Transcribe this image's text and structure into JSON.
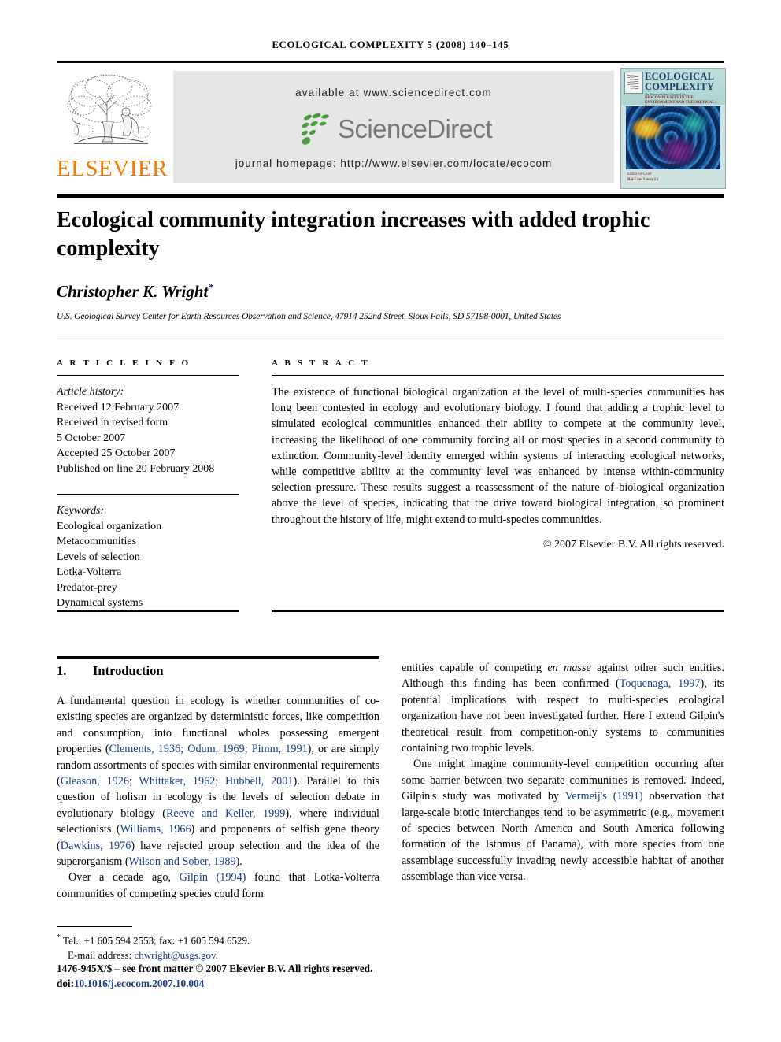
{
  "running_head": "ECOLOGICAL COMPLEXITY 5 (2008) 140–145",
  "masthead": {
    "publisher_name": "ELSEVIER",
    "available_at": "available at www.sciencedirect.com",
    "sciencedirect_logo_text": "ScienceDirect",
    "journal_homepage": "journal homepage: http://www.elsevier.com/locate/ecocom",
    "cover": {
      "title_line1": "ECOLOGICAL",
      "title_line2": "COMPLEXITY",
      "subtitle_italic": "An International Journal on",
      "subtitle_bold": "BIOCOMPLEXITY IN THE ENVIRONMENT AND THEORETICAL ECOLOGY",
      "footer_line1": "Editor-in-Chief",
      "footer_line2": "Bai-Lian Larry Li"
    }
  },
  "title": "Ecological community integration increases with added trophic complexity",
  "author": "Christopher K. Wright",
  "author_footnote_marker": "*",
  "affiliation": "U.S. Geological Survey Center for Earth Resources Observation and Science, 47914 252nd Street, Sioux Falls, SD 57198-0001, United States",
  "article_info": {
    "heading": "A R T I C L E   I N F O",
    "history_label": "Article history:",
    "history": [
      "Received 12 February 2007",
      "Received in revised form",
      "5 October 2007",
      "Accepted 25 October 2007",
      "Published on line 20 February 2008"
    ],
    "keywords_label": "Keywords:",
    "keywords": [
      "Ecological organization",
      "Metacommunities",
      "Levels of selection",
      "Lotka-Volterra",
      "Predator-prey",
      "Dynamical systems"
    ]
  },
  "abstract": {
    "heading": "A B S T R A C T",
    "text": "The existence of functional biological organization at the level of multi-species communities has long been contested in ecology and evolutionary biology. I found that adding a trophic level to simulated ecological communities enhanced their ability to compete at the community level, increasing the likelihood of one community forcing all or most species in a second community to extinction. Community-level identity emerged within systems of interacting ecological networks, while competitive ability at the community level was enhanced by intense within-community selection pressure. These results suggest a reassessment of the nature of biological organization above the level of species, indicating that the drive toward biological integration, so prominent throughout the history of life, might extend to multi-species communities.",
    "copyright": "© 2007 Elsevier B.V. All rights reserved."
  },
  "introduction": {
    "number": "1.",
    "heading": "Introduction",
    "left_paragraphs": [
      {
        "runs": [
          {
            "t": "A fundamental question in ecology is whether communities of co-existing species are organized by deterministic forces, like competition and consumption, into functional wholes possessing emergent properties ("
          },
          {
            "t": "Clements, 1936; Odum, 1969; Pimm, 1991",
            "style": "cite"
          },
          {
            "t": "), or are simply random assortments of species with similar environmental requirements ("
          },
          {
            "t": "Gleason, 1926; Whittaker, 1962; Hubbell, 2001",
            "style": "cite"
          },
          {
            "t": "). Parallel to this question of holism in ecology is the levels of selection debate in evolutionary biology ("
          },
          {
            "t": "Reeve and Keller, 1999",
            "style": "cite"
          },
          {
            "t": "), where individual selectionists ("
          },
          {
            "t": "Williams, 1966",
            "style": "cite"
          },
          {
            "t": ") and proponents of selfish gene theory ("
          },
          {
            "t": "Dawkins, 1976",
            "style": "cite"
          },
          {
            "t": ") have rejected group selection and the idea of the superorganism ("
          },
          {
            "t": "Wilson and Sober, 1989",
            "style": "cite"
          },
          {
            "t": ")."
          }
        ]
      },
      {
        "runs": [
          {
            "t": "Over a decade ago, "
          },
          {
            "t": "Gilpin (1994)",
            "style": "cite"
          },
          {
            "t": " found that Lotka-Volterra communities of competing species could form"
          }
        ]
      }
    ],
    "right_paragraphs": [
      {
        "runs": [
          {
            "t": "entities capable of competing "
          },
          {
            "t": "en masse",
            "style": "ital"
          },
          {
            "t": " against other such entities. Although this finding has been confirmed ("
          },
          {
            "t": "Toquenaga, 1997",
            "style": "cite"
          },
          {
            "t": "), its potential implications with respect to multi-species ecological organization have not been investigated further. Here I extend Gilpin's theoretical result from competition-only systems to communities containing two trophic levels."
          }
        ]
      },
      {
        "runs": [
          {
            "t": "One might imagine community-level competition occurring after some barrier between two separate communities is removed. Indeed, Gilpin's study was motivated by "
          },
          {
            "t": "Vermeij's (1991)",
            "style": "cite"
          },
          {
            "t": " observation that large-scale biotic interchanges tend to be asymmetric (e.g., movement of species between North America and South America following formation of the Isthmus of Panama), with more species from one assemblage successfully invading newly accessible habitat of another assemblage than vice versa."
          }
        ]
      }
    ]
  },
  "footnotes": {
    "tel_marker": "*",
    "tel": "Tel.: +1 605 594 2553; fax: +1 605 594 6529.",
    "email_label": "E-mail address:",
    "email": "chwright@usgs.gov.",
    "front_matter": "1476-945X/$ – see front matter © 2007 Elsevier B.V. All rights reserved.",
    "doi_label": "doi:",
    "doi": "10.1016/j.ecocom.2007.10.004"
  },
  "colors": {
    "link": "#1a3c8c",
    "elsevier_orange": "#F07D00",
    "sciencedirect_green": "#4a9c3e",
    "sciencedirect_gray": "#77777a",
    "banner_gray": "#e6e6e6"
  }
}
